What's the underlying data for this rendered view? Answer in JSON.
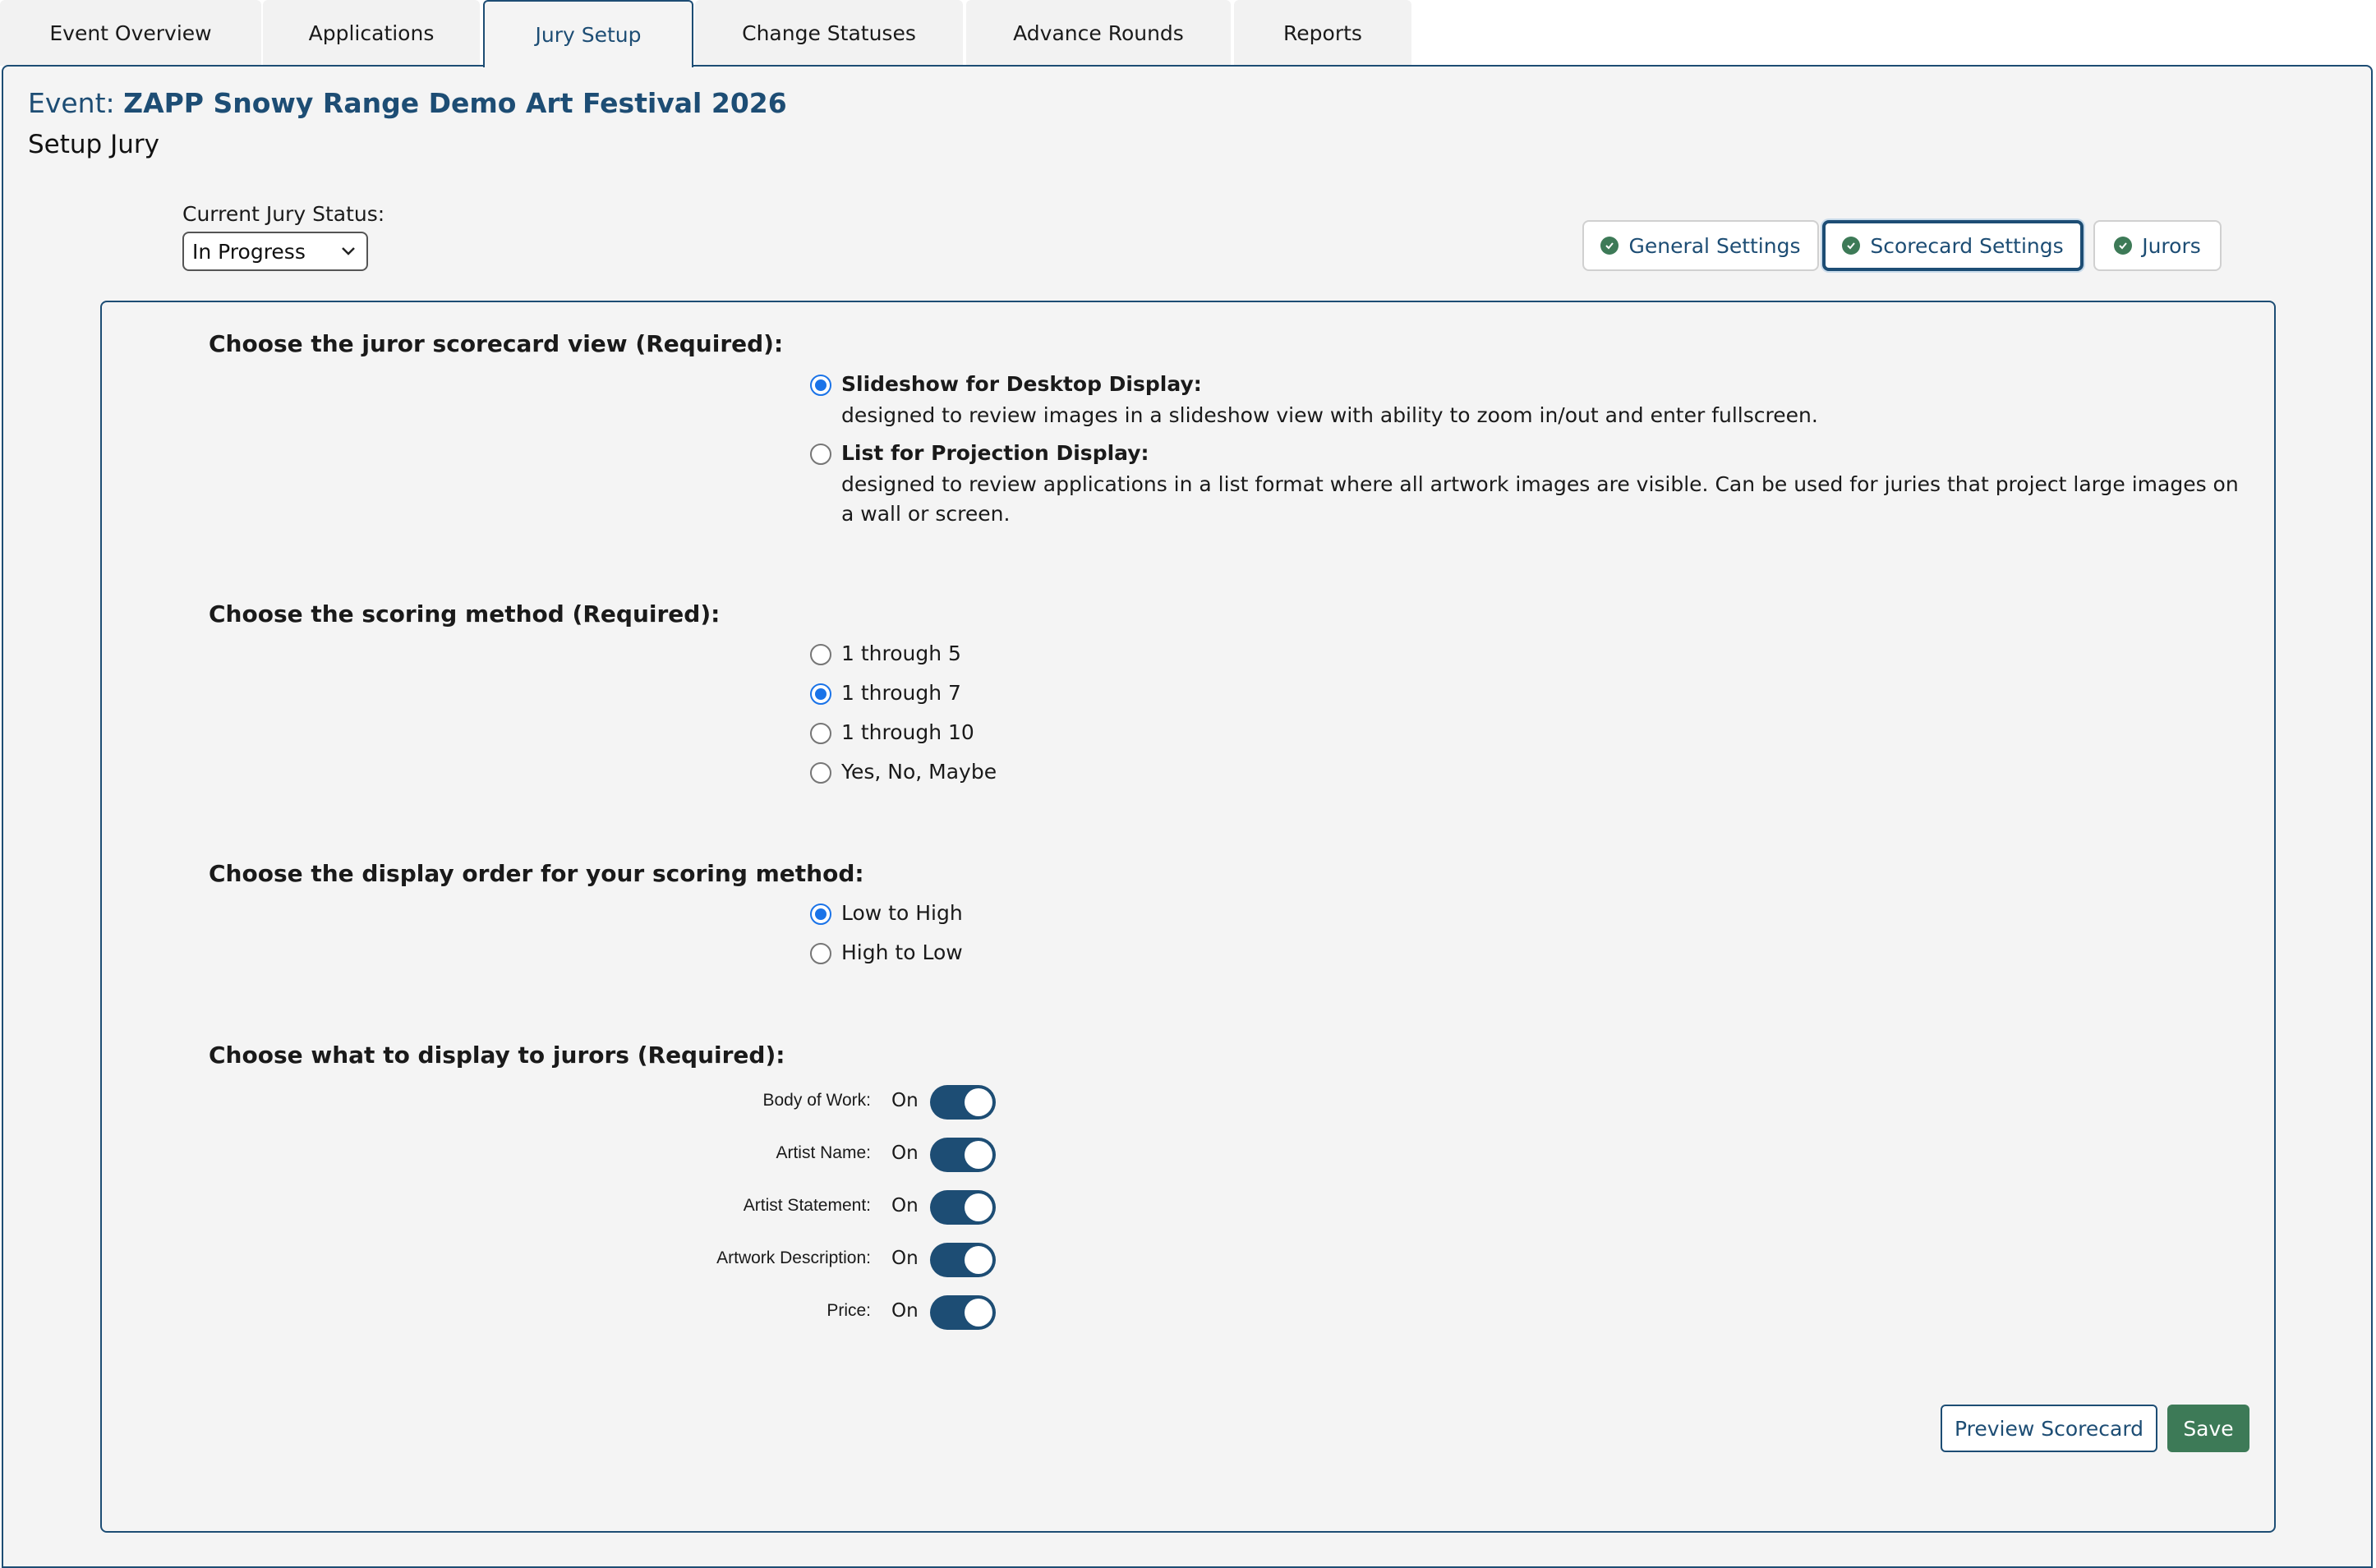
{
  "tabs": [
    {
      "label": "Event Overview"
    },
    {
      "label": "Applications"
    },
    {
      "label": "Jury Setup",
      "active": true
    },
    {
      "label": "Change Statuses"
    },
    {
      "label": "Advance Rounds"
    },
    {
      "label": "Reports"
    }
  ],
  "header": {
    "event_prefix": "Event:",
    "event_name": "ZAPP Snowy Range Demo Art Festival 2026",
    "page_title": "Setup Jury"
  },
  "jury_status": {
    "label": "Current Jury Status:",
    "value": "In Progress"
  },
  "sub_nav": {
    "active": "Scorecard Settings",
    "items": [
      {
        "label": "General Settings"
      },
      {
        "label": "Scorecard Settings"
      },
      {
        "label": "Jurors"
      }
    ]
  },
  "scorecard_view": {
    "title": "Choose the juror scorecard view (Required):",
    "options": [
      {
        "label": "Slideshow for Desktop Display:",
        "desc": "designed to review images in a slideshow view with ability to zoom in/out and enter fullscreen.",
        "checked": true
      },
      {
        "label": "List for Projection Display:",
        "desc": "designed to review applications in a list format where all artwork images are visible. Can be used for juries that project large images on a wall or screen.",
        "checked": false
      }
    ]
  },
  "scoring_method": {
    "title": "Choose the scoring method (Required):",
    "options": [
      {
        "label": "1 through 5",
        "checked": false
      },
      {
        "label": "1 through 7",
        "checked": true
      },
      {
        "label": "1 through 10",
        "checked": false
      },
      {
        "label": "Yes, No, Maybe",
        "checked": false
      }
    ]
  },
  "display_order": {
    "title": "Choose the display order for your scoring method:",
    "options": [
      {
        "label": "Low to High",
        "checked": true
      },
      {
        "label": "High to Low",
        "checked": false
      }
    ]
  },
  "juror_display": {
    "title": "Choose what to display to jurors (Required):",
    "toggles": [
      {
        "label": "Body of Work:",
        "state": "On"
      },
      {
        "label": "Artist Name:",
        "state": "On"
      },
      {
        "label": "Artist Statement:",
        "state": "On"
      },
      {
        "label": "Artwork Description:",
        "state": "On"
      },
      {
        "label": "Price:",
        "state": "On"
      }
    ]
  },
  "actions": {
    "preview": "Preview Scorecard",
    "save": "Save"
  },
  "colors": {
    "brand_navy": "#1d4d74",
    "save_green": "#3d7a57",
    "radio_blue": "#1a73e8",
    "panel_bg": "#f4f4f4"
  }
}
